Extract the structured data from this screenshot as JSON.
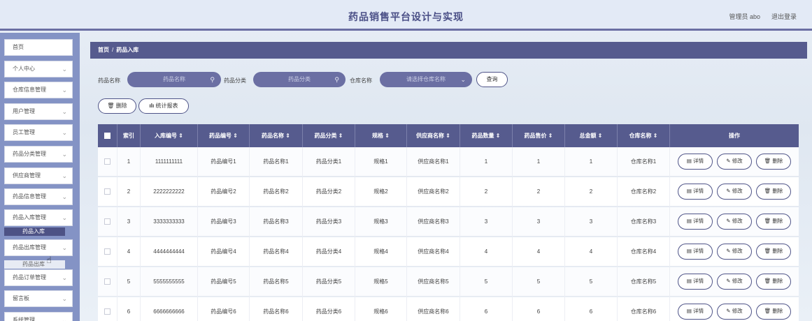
{
  "header": {
    "title": "药品销售平台设计与实现",
    "user": "管理员 abo",
    "logout": "退出登录"
  },
  "sidebar": {
    "items": [
      {
        "label": "首页",
        "chev": ""
      },
      {
        "label": "个人中心",
        "chev": "⌄"
      },
      {
        "label": "仓库信息管理",
        "chev": "⌄"
      },
      {
        "label": "用户管理",
        "chev": "⌄"
      },
      {
        "label": "员工管理",
        "chev": "⌄"
      },
      {
        "label": "药品分类管理",
        "chev": "⌄"
      },
      {
        "label": "供应商管理",
        "chev": "⌄"
      },
      {
        "label": "药品信息管理",
        "chev": "⌄"
      },
      {
        "label": "药品入库管理",
        "chev": "⌄"
      },
      {
        "label": "药品出库管理",
        "chev": "⌄"
      },
      {
        "label": "药品订单管理",
        "chev": "⌄"
      },
      {
        "label": "留言板",
        "chev": "⌄"
      },
      {
        "label": "系统管理",
        "chev": "⌄"
      }
    ],
    "sub_in": "药品入库",
    "sub_out": "药品出库"
  },
  "breadcrumb": {
    "home": "首页",
    "sep": "/",
    "current": "药品入库"
  },
  "search": {
    "name_label": "药品名称",
    "name_placeholder": "药品名称",
    "category_label": "药品分类",
    "category_placeholder": "药品分类",
    "warehouse_label": "仓库名称",
    "warehouse_placeholder": "请选择仓库名称",
    "query": "查询"
  },
  "toolbar": {
    "delete": "删除",
    "report": "统计报表"
  },
  "table": {
    "headers": {
      "index": "索引",
      "in_no": "入库编号 ⇕",
      "drug_no": "药品编号 ⇕",
      "drug_name": "药品名称 ⇕",
      "category": "药品分类 ⇕",
      "spec": "规格 ⇕",
      "supplier": "供应商名称 ⇕",
      "qty": "药品数量 ⇕",
      "price": "药品售价 ⇕",
      "total": "总金额 ⇕",
      "warehouse": "仓库名称 ⇕",
      "ops": "操作"
    },
    "actions": {
      "detail": "详情",
      "edit": "修改",
      "delete": "删除"
    },
    "rows": [
      {
        "index": "1",
        "in_no": "1111111111",
        "drug_no": "药品编号1",
        "drug_name": "药品名称1",
        "category": "药品分类1",
        "spec": "规格1",
        "supplier": "供应商名称1",
        "qty": "1",
        "price": "1",
        "total": "1",
        "warehouse": "仓库名称1"
      },
      {
        "index": "2",
        "in_no": "2222222222",
        "drug_no": "药品编号2",
        "drug_name": "药品名称2",
        "category": "药品分类2",
        "spec": "规格2",
        "supplier": "供应商名称2",
        "qty": "2",
        "price": "2",
        "total": "2",
        "warehouse": "仓库名称2"
      },
      {
        "index": "3",
        "in_no": "3333333333",
        "drug_no": "药品编号3",
        "drug_name": "药品名称3",
        "category": "药品分类3",
        "spec": "规格3",
        "supplier": "供应商名称3",
        "qty": "3",
        "price": "3",
        "total": "3",
        "warehouse": "仓库名称3"
      },
      {
        "index": "4",
        "in_no": "4444444444",
        "drug_no": "药品编号4",
        "drug_name": "药品名称4",
        "category": "药品分类4",
        "spec": "规格4",
        "supplier": "供应商名称4",
        "qty": "4",
        "price": "4",
        "total": "4",
        "warehouse": "仓库名称4"
      },
      {
        "index": "5",
        "in_no": "5555555555",
        "drug_no": "药品编号5",
        "drug_name": "药品名称5",
        "category": "药品分类5",
        "spec": "规格5",
        "supplier": "供应商名称5",
        "qty": "5",
        "price": "5",
        "total": "5",
        "warehouse": "仓库名称5"
      },
      {
        "index": "6",
        "in_no": "6666666666",
        "drug_no": "药品编号6",
        "drug_name": "药品名称6",
        "category": "药品分类6",
        "spec": "规格6",
        "supplier": "供应商名称6",
        "qty": "6",
        "price": "6",
        "total": "6",
        "warehouse": "仓库名称6"
      }
    ]
  },
  "icons": {
    "search": "search-icon",
    "chevron": "chevron-down-icon",
    "trash": "trash-icon",
    "chart": "bar-chart-icon",
    "doc": "document-icon",
    "pen": "pen-icon",
    "cursor": "hand-cursor-icon"
  },
  "colors": {
    "accent": "#565b8e",
    "sidebar": "#8493c5",
    "header_bg": "#e3eaf6"
  }
}
